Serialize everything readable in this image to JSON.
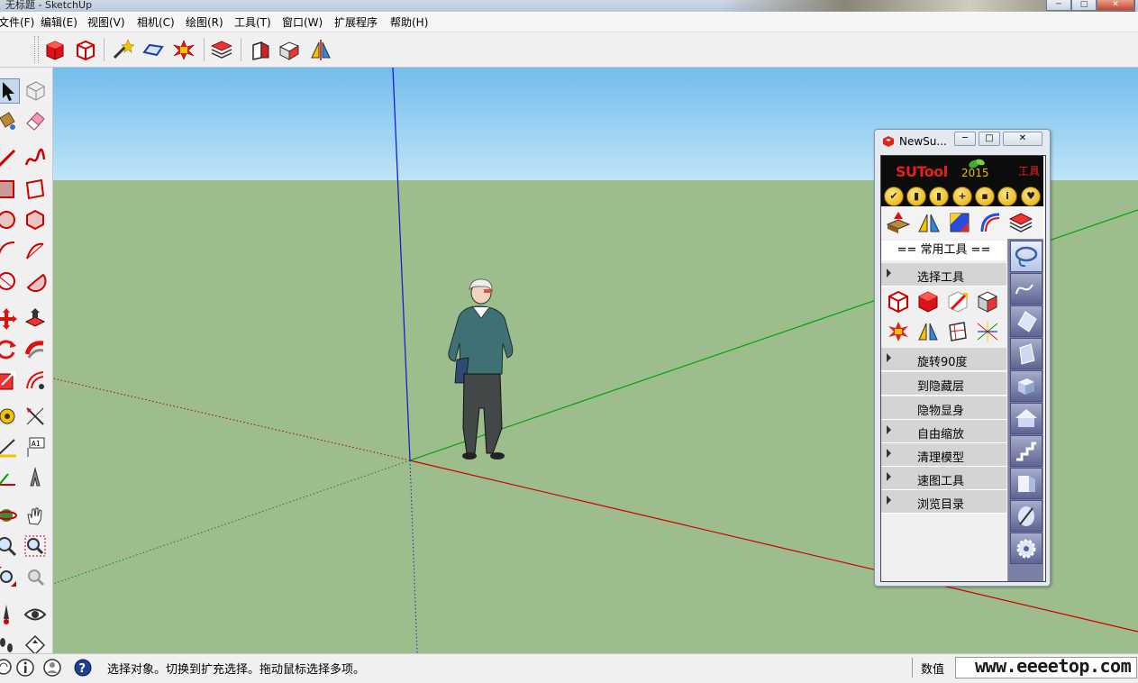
{
  "window": {
    "title": "无标题 - SketchUp",
    "minimize": "─",
    "maximize": "□",
    "close": "✕"
  },
  "menu": [
    {
      "label": "文件(F)"
    },
    {
      "label": "编辑(E)"
    },
    {
      "label": "视图(V)"
    },
    {
      "label": "相机(C)"
    },
    {
      "label": "绘图(R)"
    },
    {
      "label": "工具(T)"
    },
    {
      "label": "窗口(W)"
    },
    {
      "label": "扩展程序"
    },
    {
      "label": "帮助(H)"
    }
  ],
  "toolbar": {
    "icons": [
      "solid-box-icon",
      "box-outline-icon",
      "magic-wand-icon",
      "face-plane-icon",
      "explode-icon",
      "layers-icon",
      "push-face-icon",
      "box-tool-icon",
      "mirror-icon"
    ]
  },
  "status": {
    "text": "选择对象。切换到扩充选择。拖动鼠标选择多项。",
    "measure_label": "数值",
    "watermark": "www.eeeetop.com"
  },
  "panel": {
    "title": "NewSu...",
    "btn_min": "─",
    "btn_restore": "□",
    "btn_close": "✕",
    "logo": "SUTool",
    "year": "2015",
    "tools_label": "工具",
    "heading": "== 常用工具 ==",
    "gold_buttons": [
      "✔",
      "▮",
      "▮",
      "+",
      "▪",
      "i",
      "♥"
    ],
    "items": [
      {
        "label": "选择工具",
        "arrow": true
      },
      {
        "label": "旋转90度",
        "arrow": true
      },
      {
        "label": "到隐藏层",
        "arrow": false
      },
      {
        "label": "隐物显身",
        "arrow": false
      },
      {
        "label": "自由缩放",
        "arrow": true
      },
      {
        "label": "清理模型",
        "arrow": true
      },
      {
        "label": "速图工具",
        "arrow": true
      },
      {
        "label": "浏览目录",
        "arrow": true
      }
    ]
  },
  "colors": {
    "sky": "#7dc2ee",
    "ground": "#9dbd8d",
    "axis_red": "#cc0000",
    "axis_green": "#0aa00a",
    "axis_blue": "#1b1bd4",
    "logo_red": "#e8201a",
    "logo_gold": "#f0c000"
  }
}
